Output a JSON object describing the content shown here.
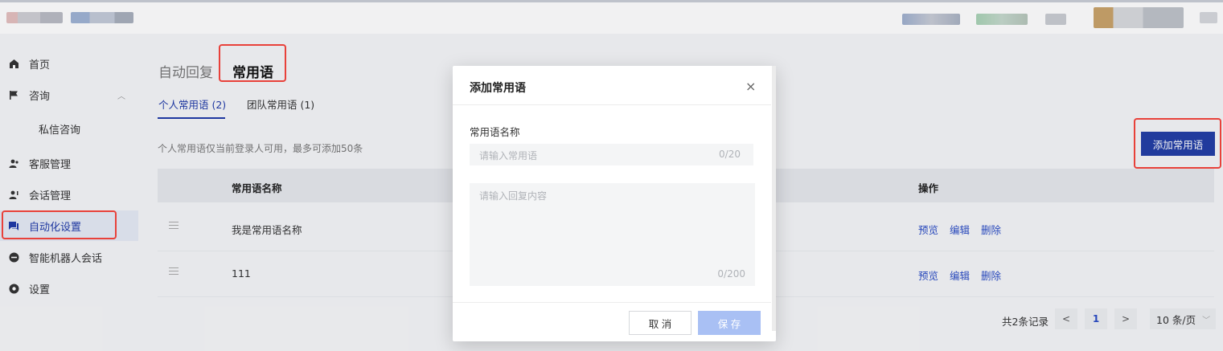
{
  "sidebar": {
    "items": [
      {
        "label": "首页",
        "icon": "home-icon"
      },
      {
        "label": "咨询",
        "icon": "flag-icon",
        "expanded": true
      },
      {
        "label": "私信咨询",
        "sub": true
      },
      {
        "label": "客服管理",
        "icon": "users-icon"
      },
      {
        "label": "会话管理",
        "icon": "user-chat-icon"
      },
      {
        "label": "自动化设置",
        "icon": "chat-bubble-icon",
        "active": true
      },
      {
        "label": "智能机器人会话",
        "icon": "robot-icon"
      },
      {
        "label": "设置",
        "icon": "gear-icon"
      }
    ]
  },
  "main": {
    "tabs": [
      {
        "label": "自动回复"
      },
      {
        "label": "常用语",
        "active": true
      }
    ],
    "subtabs": [
      {
        "label": "个人常用语 (2)",
        "active": true
      },
      {
        "label": "团队常用语 (1)"
      }
    ],
    "hint": "个人常用语仅当前登录人可用，最多可添加50条",
    "add_button": "添加常用语",
    "table": {
      "columns": [
        "常用语名称",
        "操作"
      ],
      "rows": [
        {
          "name": "我是常用语名称",
          "ops": [
            "预览",
            "编辑",
            "删除"
          ]
        },
        {
          "name": "111",
          "ops": [
            "预览",
            "编辑",
            "删除"
          ]
        }
      ]
    },
    "pagination": {
      "total": "共2条记录",
      "prev": "<",
      "page": "1",
      "next": ">",
      "page_size": "10 条/页"
    }
  },
  "dialog": {
    "title": "添加常用语",
    "close": "×",
    "field_label": "常用语名称",
    "name_placeholder": "请输入常用语",
    "name_count": "0/20",
    "content_placeholder": "请输入回复内容",
    "content_count": "0/200",
    "cancel": "取 消",
    "save": "保 存"
  },
  "colors": {
    "accent": "#233ea5",
    "link": "#2a4cc5",
    "highlight": "#e8413a",
    "save_disabled": "#a9c0f4"
  }
}
